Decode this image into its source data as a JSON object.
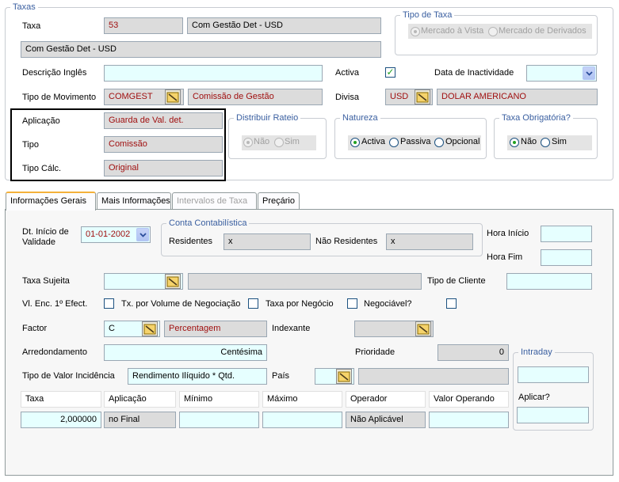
{
  "taxas": {
    "legend": "Taxas",
    "taxa_label": "Taxa",
    "taxa_code": "53",
    "taxa_name": "Com Gestão Det - USD",
    "taxa_desc": "Com Gestão Det - USD",
    "tipo_taxa": {
      "legend": "Tipo de Taxa",
      "options": [
        "Mercado à Vista",
        "Mercado de Derivados"
      ],
      "selected": "Mercado à Vista"
    },
    "descricao_ingles_label": "Descrição Inglês",
    "descricao_ingles_value": "",
    "activa_label": "Activa",
    "activa_checked": "✓",
    "data_inactividade_label": "Data de Inactividade",
    "tipo_movimento_label": "Tipo de Movimento",
    "tipo_movimento_code": "COMGEST",
    "tipo_movimento_desc": "Comissão de Gestão",
    "divisa_label": "Divisa",
    "divisa_code": "USD",
    "divisa_desc": "DOLAR AMERICANO",
    "aplicacao_label": "Aplicação",
    "aplicacao_value": "Guarda de Val. det.",
    "tipo_label": "Tipo",
    "tipo_value": "Comissão",
    "tipo_calc_label": "Tipo Cálc.",
    "tipo_calc_value": "Original",
    "distribuir_rateio": {
      "legend": "Distribuir Rateio",
      "options": [
        "Não",
        "Sim"
      ],
      "selected": "Não"
    },
    "natureza": {
      "legend": "Natureza",
      "options": [
        "Activa",
        "Passiva",
        "Opcional"
      ],
      "selected": "Activa"
    },
    "taxa_obrigatoria": {
      "legend": "Taxa Obrigatória?",
      "options": [
        "Não",
        "Sim"
      ],
      "selected": "Não"
    }
  },
  "tabs": [
    "Informações Gerais",
    "Mais Informações",
    "Intervalos de Taxa",
    "Preçário"
  ],
  "active_tab": "Informações Gerais",
  "info": {
    "dt_inicio_label": "Dt. Início de Validade",
    "dt_inicio_value": "01-01-2002",
    "conta_contabilistica": {
      "legend": "Conta Contabilística",
      "residentes_label": "Residentes",
      "residentes_value": "x",
      "nao_residentes_label": "Não Residentes",
      "nao_residentes_value": "x"
    },
    "hora_inicio_label": "Hora Início",
    "hora_fim_label": "Hora Fim",
    "taxa_sujeita_label": "Taxa Sujeita",
    "tipo_cliente_label": "Tipo de Cliente",
    "vl_enc_label": "Vl. Enc. 1º Efect.",
    "tx_volume_label": "Tx. por Volume de Negociação",
    "taxa_negocio_label": "Taxa por Negócio",
    "negociavel_label": "Negociável?",
    "factor_label": "Factor",
    "factor_code": "C",
    "factor_desc": "Percentagem",
    "indexante_label": "Indexante",
    "arredondamento_label": "Arredondamento",
    "arredondamento_value": "Centésima",
    "prioridade_label": "Prioridade",
    "prioridade_value": "0",
    "tipo_valor_incidencia_label": "Tipo de Valor Incidência",
    "tipo_valor_incidencia_value": "Rendimento Ilíquido * Qtd.",
    "pais_label": "País",
    "intraday": {
      "legend": "Intraday",
      "aplicar_label": "Aplicar?"
    },
    "grid_headers": [
      "Taxa",
      "Aplicação",
      "Mínimo",
      "Máximo",
      "Operador",
      "Valor Operando"
    ],
    "grid_values": [
      "2,000000",
      "no Final",
      "",
      "",
      "Não Aplicável",
      ""
    ]
  },
  "colors": {
    "field_cyan": "#e6ffff",
    "field_gray": "#dcdcdc",
    "legend_blue": "#3a5fa0",
    "text_red": "#a01010",
    "check_green": "#21a121"
  }
}
